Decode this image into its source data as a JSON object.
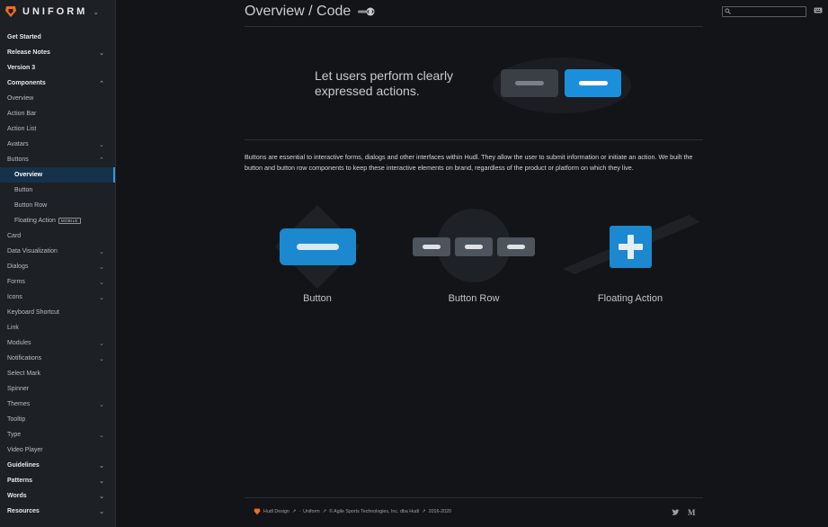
{
  "brand": {
    "name": "UNIFORM",
    "accent": "#f26b21"
  },
  "page": {
    "title": "Overview / Code"
  },
  "search": {
    "placeholder": ""
  },
  "sidebar": {
    "items": [
      {
        "label": "Get Started",
        "level": "top",
        "caret": ""
      },
      {
        "label": "Release Notes",
        "level": "top",
        "caret": "down"
      },
      {
        "label": "Version 3",
        "level": "top",
        "caret": ""
      },
      {
        "label": "Components",
        "level": "top",
        "caret": "up"
      },
      {
        "label": "Overview",
        "level": "item",
        "caret": ""
      },
      {
        "label": "Action Bar",
        "level": "item",
        "caret": ""
      },
      {
        "label": "Action List",
        "level": "item",
        "caret": ""
      },
      {
        "label": "Avatars",
        "level": "item",
        "caret": "down"
      },
      {
        "label": "Buttons",
        "level": "item",
        "caret": "up"
      },
      {
        "label": "Overview",
        "level": "sub",
        "caret": "",
        "active": true
      },
      {
        "label": "Button",
        "level": "sub",
        "caret": ""
      },
      {
        "label": "Button Row",
        "level": "sub",
        "caret": ""
      },
      {
        "label": "Floating Action",
        "level": "sub",
        "caret": "",
        "badge": "MOBILE"
      },
      {
        "label": "Card",
        "level": "item",
        "caret": ""
      },
      {
        "label": "Data Visualization",
        "level": "item",
        "caret": "down"
      },
      {
        "label": "Dialogs",
        "level": "item",
        "caret": "down"
      },
      {
        "label": "Forms",
        "level": "item",
        "caret": "down"
      },
      {
        "label": "Icons",
        "level": "item",
        "caret": "down"
      },
      {
        "label": "Keyboard Shortcut",
        "level": "item",
        "caret": ""
      },
      {
        "label": "Link",
        "level": "item",
        "caret": ""
      },
      {
        "label": "Modules",
        "level": "item",
        "caret": "down"
      },
      {
        "label": "Notifications",
        "level": "item",
        "caret": "down"
      },
      {
        "label": "Select Mark",
        "level": "item",
        "caret": ""
      },
      {
        "label": "Spinner",
        "level": "item",
        "caret": ""
      },
      {
        "label": "Themes",
        "level": "item",
        "caret": "down"
      },
      {
        "label": "Tooltip",
        "level": "item",
        "caret": ""
      },
      {
        "label": "Type",
        "level": "item",
        "caret": "down"
      },
      {
        "label": "Video Player",
        "level": "item",
        "caret": ""
      },
      {
        "label": "Guidelines",
        "level": "top",
        "caret": "down"
      },
      {
        "label": "Patterns",
        "level": "top",
        "caret": "down"
      },
      {
        "label": "Words",
        "level": "top",
        "caret": "down"
      },
      {
        "label": "Resources",
        "level": "top",
        "caret": "down"
      }
    ]
  },
  "hero": {
    "text": "Let users perform clearly expressed actions."
  },
  "intro": {
    "text": "Buttons are essential to interactive forms, dialogs and other interfaces within Hudl. They allow the user to submit information or initiate an action. We built the button and button row components to keep these interactive elements on brand, regardless of the product or platform on which they live."
  },
  "cards": [
    {
      "label": "Button"
    },
    {
      "label": "Button Row"
    },
    {
      "label": "Floating Action"
    }
  ],
  "footer": {
    "hudl_design": "Hudl Design",
    "separator": "·",
    "uniform": "Uniform",
    "copyright": "© Agile Sports Technologies, Inc. dba Hudl",
    "years": "2016-2020"
  },
  "colors": {
    "primary": "#1b88cf",
    "secondary": "#3a3f46",
    "background": "#131417",
    "sidebar": "#1d2025"
  }
}
